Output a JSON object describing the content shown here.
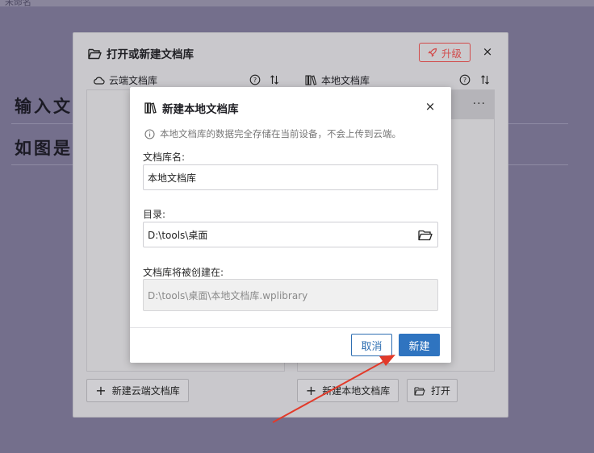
{
  "background": {
    "title_fragment": "未命名",
    "heading1": "输入文",
    "heading2": "如图是"
  },
  "outer_dialog": {
    "title": "打开或新建文档库",
    "upgrade_label": "升级",
    "close_label": "×",
    "cloud_column": {
      "label": "云端文档库",
      "new_button": "新建云端文档库"
    },
    "local_column": {
      "label": "本地文档库",
      "row_menu": "···",
      "new_button": "新建本地文档库",
      "open_button": "打开"
    }
  },
  "inner_dialog": {
    "title": "新建本地文档库",
    "close_label": "×",
    "info_text": "本地文档库的数据完全存储在当前设备，不会上传到云端。",
    "name_label": "文档库名:",
    "name_value": "本地文档库",
    "dir_label": "目录:",
    "dir_value": "D:\\tools\\桌面",
    "path_label": "文档库将被创建在:",
    "path_value": "D:\\tools\\桌面\\本地文档库.wplibrary",
    "cancel_label": "取消",
    "create_label": "新建"
  },
  "colors": {
    "overlay": "#746f8c",
    "primary": "#2f74c0",
    "upgrade": "#d24a4a",
    "annotation_arrow": "#e23a2a"
  }
}
